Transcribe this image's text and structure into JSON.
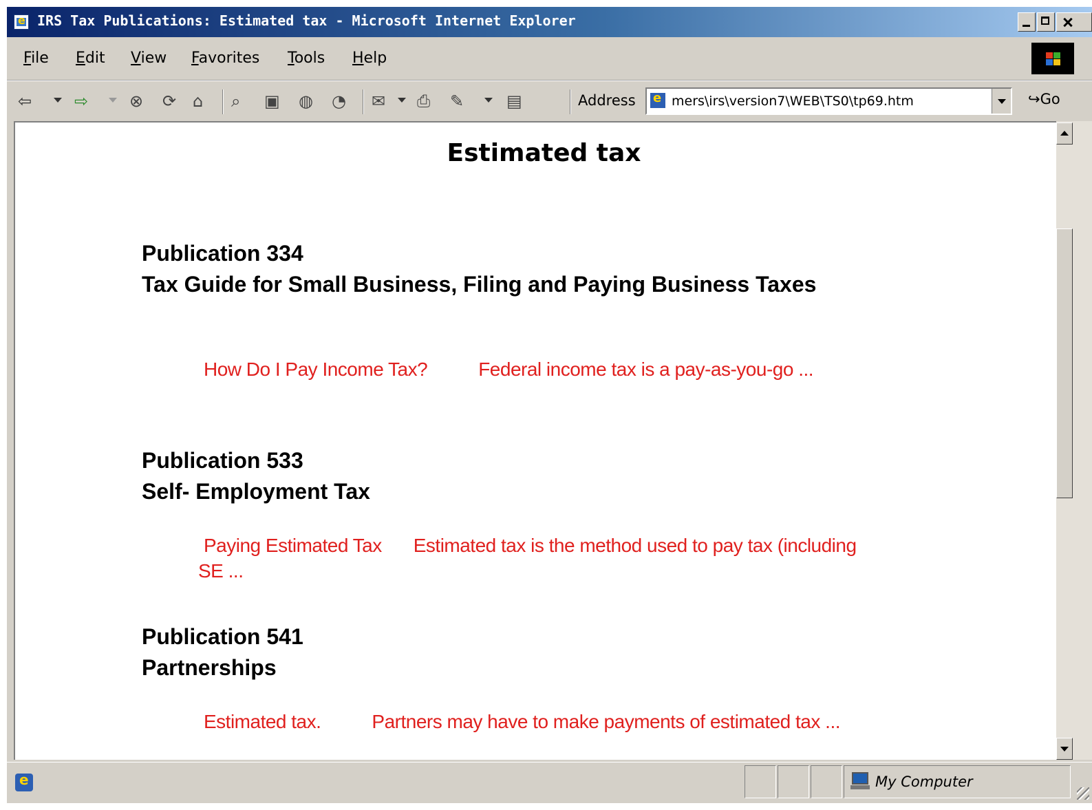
{
  "window": {
    "title": "IRS Tax Publications: Estimated tax - Microsoft Internet Explorer"
  },
  "menu": [
    "File",
    "Edit",
    "View",
    "Favorites",
    "Tools",
    "Help"
  ],
  "toolbar": {
    "address_label": "Address",
    "address_value": "mers\\irs\\version7\\WEB\\TS0\\tp69.htm",
    "go_label": "Go"
  },
  "page": {
    "heading": "Estimated tax",
    "publications": [
      {
        "number": "Publication 334",
        "title": "Tax Guide for Small Business, Filing and Paying Business Taxes",
        "link_topic": "How Do I Pay Income Tax?",
        "link_excerpt": "Federal income tax is a pay-as-you-go ..."
      },
      {
        "number": "Publication 533",
        "title": "Self- Employment Tax",
        "link_topic": "Paying Estimated Tax",
        "link_excerpt": "Estimated tax is the method used to pay tax (including SE ..."
      },
      {
        "number": "Publication 541",
        "title": "Partnerships",
        "link_topic": "Estimated tax.",
        "link_excerpt": "Partners may have to make payments of estimated tax ..."
      }
    ]
  },
  "statusbar": {
    "zone": "My Computer"
  },
  "icons": {
    "toolbar": [
      "back-icon",
      "forward-icon",
      "stop-icon",
      "refresh-icon",
      "home-icon",
      "search-icon",
      "favorites-icon",
      "media-icon",
      "history-icon",
      "mail-icon",
      "print-icon",
      "edit-icon",
      "discuss-icon"
    ]
  },
  "colors": {
    "title_bar": "#0a246a",
    "link_text": "#e0201e",
    "chrome": "#d4d0c8"
  }
}
